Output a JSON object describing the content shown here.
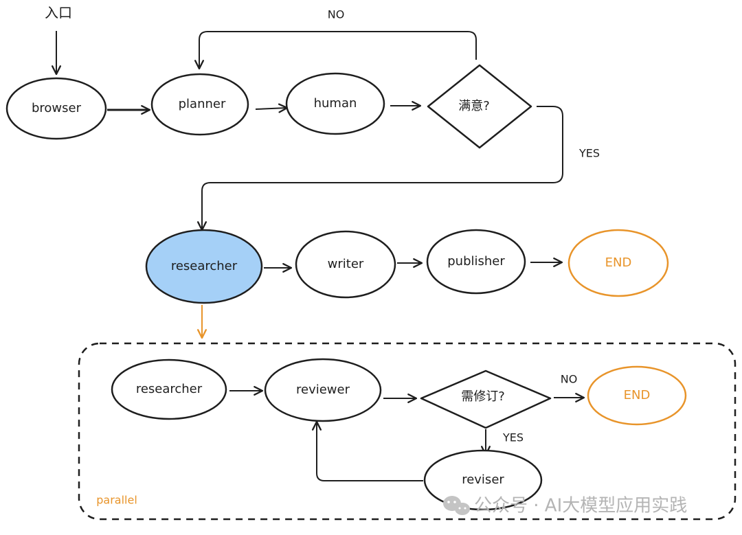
{
  "diagram": {
    "entry_label": "入口",
    "colors": {
      "stroke": "#1e1e1e",
      "highlight_fill": "#a5d0f7",
      "end_color": "#e8942a",
      "watermark": "#b4b4b4"
    },
    "top_flow": {
      "nodes": {
        "browser": "browser",
        "planner": "planner",
        "human": "human",
        "satisfied_decision": "满意?"
      },
      "edge_labels": {
        "no": "NO",
        "yes": "YES"
      }
    },
    "middle_flow": {
      "nodes": {
        "researcher": "researcher",
        "writer": "writer",
        "publisher": "publisher",
        "end": "END"
      }
    },
    "parallel_group": {
      "label": "parallel",
      "nodes": {
        "researcher": "researcher",
        "reviewer": "reviewer",
        "revision_decision": "需修订?",
        "end": "END",
        "reviser": "reviser"
      },
      "edge_labels": {
        "no": "NO",
        "yes": "YES"
      }
    },
    "watermark": "公众号 · AI大模型应用实践"
  }
}
